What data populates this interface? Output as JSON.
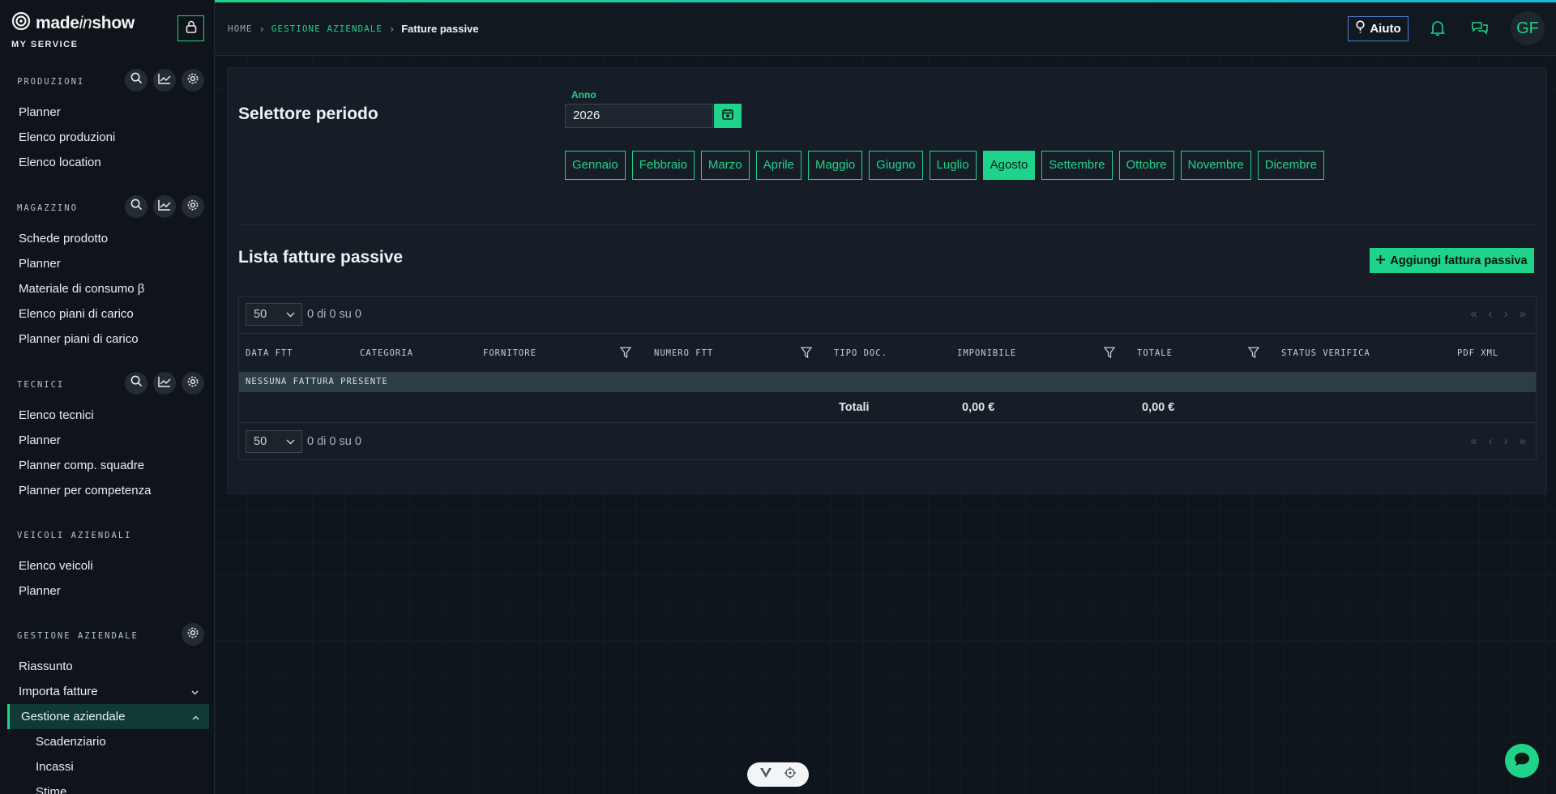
{
  "brand": {
    "name_pre": "made",
    "name_italic": "in",
    "name_post": "show",
    "subtitle": "MY SERVICE"
  },
  "sidebar": {
    "sections": [
      {
        "title": "PRODUZIONI",
        "items": [
          "Planner",
          "Elenco produzioni",
          "Elenco location"
        ]
      },
      {
        "title": "MAGAZZINO",
        "items": [
          "Schede prodotto",
          "Planner",
          "Materiale di consumo β",
          "Elenco piani di carico",
          "Planner piani di carico"
        ]
      },
      {
        "title": "TECNICI",
        "items": [
          "Elenco tecnici",
          "Planner",
          "Planner comp. squadre",
          "Planner per competenza"
        ]
      },
      {
        "title": "VEICOLI AZIENDALI",
        "items": [
          "Elenco veicoli",
          "Planner"
        ]
      },
      {
        "title": "GESTIONE AZIENDALE",
        "items": [
          "Riassunto",
          "Importa fatture",
          "Gestione aziendale",
          "Scadenziario",
          "Incassi",
          "Stime"
        ]
      }
    ]
  },
  "breadcrumb": {
    "home": "HOME",
    "section": "GESTIONE AZIENDALE",
    "current": "Fatture passive"
  },
  "topbar": {
    "help_label": "Aiuto",
    "avatar_initials": "GF"
  },
  "period": {
    "title": "Selettore periodo",
    "year_label": "Anno",
    "year_value": "2026",
    "months": [
      "Gennaio",
      "Febbraio",
      "Marzo",
      "Aprile",
      "Maggio",
      "Giugno",
      "Luglio",
      "Agosto",
      "Settembre",
      "Ottobre",
      "Novembre",
      "Dicembre"
    ],
    "selected_month": "Agosto"
  },
  "list": {
    "title": "Lista fatture passive",
    "add_label": "Aggiungi fattura passiva",
    "page_size": "50",
    "page_info": "0 di 0 su 0",
    "columns": [
      "DATA FTT",
      "CATEGORIA",
      "FORNITORE",
      "NUMERO FTT",
      "TIPO DOC.",
      "IMPONIBILE",
      "TOTALE",
      "STATUS VERIFICA",
      "PDF XML"
    ],
    "empty_text": "NESSUNA FATTURA PRESENTE",
    "totals_label": "Totali",
    "total_imponibile": "0,00 €",
    "total_totale": "0,00 €"
  },
  "colors": {
    "accent": "#1fd38a",
    "help_border": "#4d7fd6",
    "background": "#0f151c",
    "panel": "#161d26"
  },
  "icons": [
    "brand-logo-icon",
    "lock-icon",
    "search-icon",
    "chart-icon",
    "gear-icon",
    "help-icon",
    "bell-icon",
    "chat-icon",
    "calendar-icon",
    "plus-icon",
    "filter-icon",
    "chevron-down-icon",
    "chevron-up-icon"
  ]
}
